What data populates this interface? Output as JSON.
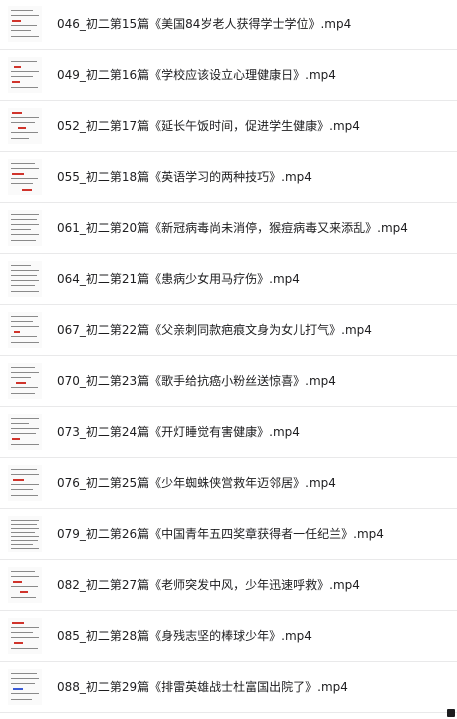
{
  "files": [
    {
      "name": "046_初二第15篇《美国84岁老人获得学士学位》.mp4",
      "thumb_icon": "video-thumbnail-icon"
    },
    {
      "name": "049_初二第16篇《学校应该设立心理健康日》.mp4",
      "thumb_icon": "video-thumbnail-icon"
    },
    {
      "name": "052_初二第17篇《延长午饭时间，促进学生健康》.mp4",
      "thumb_icon": "video-thumbnail-icon"
    },
    {
      "name": "055_初二第18篇《英语学习的两种技巧》.mp4",
      "thumb_icon": "video-thumbnail-icon"
    },
    {
      "name": "061_初二第20篇《新冠病毒尚未消停，猴痘病毒又来添乱》.mp4",
      "thumb_icon": "video-thumbnail-icon"
    },
    {
      "name": "064_初二第21篇《患病少女用马疗伤》.mp4",
      "thumb_icon": "video-thumbnail-icon"
    },
    {
      "name": "067_初二第22篇《父亲刺同款疤痕文身为女儿打气》.mp4",
      "thumb_icon": "video-thumbnail-icon"
    },
    {
      "name": "070_初二第23篇《歌手给抗癌小粉丝送惊喜》.mp4",
      "thumb_icon": "video-thumbnail-icon"
    },
    {
      "name": "073_初二第24篇《开灯睡觉有害健康》.mp4",
      "thumb_icon": "video-thumbnail-icon"
    },
    {
      "name": "076_初二第25篇《少年蜘蛛侠営救年迈邻居》.mp4",
      "thumb_icon": "video-thumbnail-icon"
    },
    {
      "name": "079_初二第26篇《中国青年五四奖章获得者一任纪兰》.mp4",
      "thumb_icon": "video-thumbnail-icon"
    },
    {
      "name": "082_初二第27篇《老师突发中风，少年迅速呼救》.mp4",
      "thumb_icon": "video-thumbnail-icon"
    },
    {
      "name": "085_初二第28篇《身残志坚的棒球少年》.mp4",
      "thumb_icon": "video-thumbnail-icon"
    },
    {
      "name": "088_初二第29篇《排雷英雄战士杜富国出院了》.mp4",
      "thumb_icon": "video-thumbnail-icon"
    }
  ]
}
